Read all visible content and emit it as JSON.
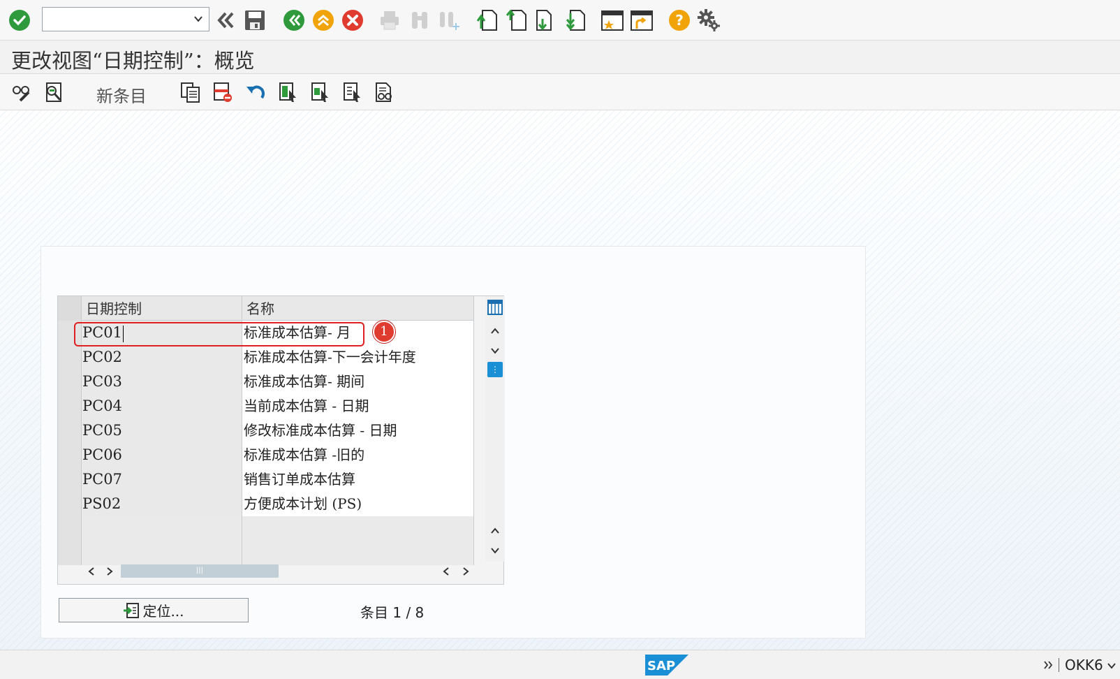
{
  "toolbar": {
    "command_field_value": "",
    "icons": [
      "enter-icon",
      "back-double-icon",
      "save-icon",
      "back-icon",
      "exit-icon",
      "cancel-icon",
      "print-icon",
      "find-icon",
      "find-next-icon",
      "first-page-icon",
      "previous-page-icon",
      "next-page-icon",
      "last-page-icon",
      "create-session-icon",
      "shortcut-icon",
      "help-icon",
      "settings-icon"
    ]
  },
  "title": "更改视图“日期控制”：概览",
  "app_toolbar": {
    "new_entries_label": "新条目",
    "icons": [
      "display-change-icon",
      "details-icon",
      "copy-as-icon",
      "delete-icon",
      "undo-icon",
      "select-all-icon",
      "select-block-icon",
      "deselect-all-icon",
      "print-view-icon"
    ]
  },
  "table": {
    "columns": [
      "日期控制",
      "名称"
    ],
    "rows": [
      {
        "code": "PC01",
        "name": "标准成本估算- 月"
      },
      {
        "code": "PC02",
        "name": "标准成本估算-下一会计年度"
      },
      {
        "code": "PC03",
        "name": "标准成本估算- 期间"
      },
      {
        "code": "PC04",
        "name": "当前成本估算 - 日期"
      },
      {
        "code": "PC05",
        "name": "修改标准成本估算 - 日期"
      },
      {
        "code": "PC06",
        "name": "标准成本估算 -旧的"
      },
      {
        "code": "PC07",
        "name": "销售订单成本估算"
      },
      {
        "code": "PS02",
        "name": "方便成本计划 (PS)"
      }
    ],
    "empty_rows": 2
  },
  "annotation": {
    "badge": "1"
  },
  "locate_button_label": "定位...",
  "entry_label": "条目",
  "entry_value": "1 / 8",
  "status": {
    "brand": "SAP",
    "transaction": "OKK6"
  },
  "colors": {
    "accent_blue": "#1a8fd6",
    "ok_green": "#2e9a3c",
    "nav_orange": "#f0a40a",
    "cancel_red": "#e03b2f",
    "highlight_red": "#e02020"
  }
}
